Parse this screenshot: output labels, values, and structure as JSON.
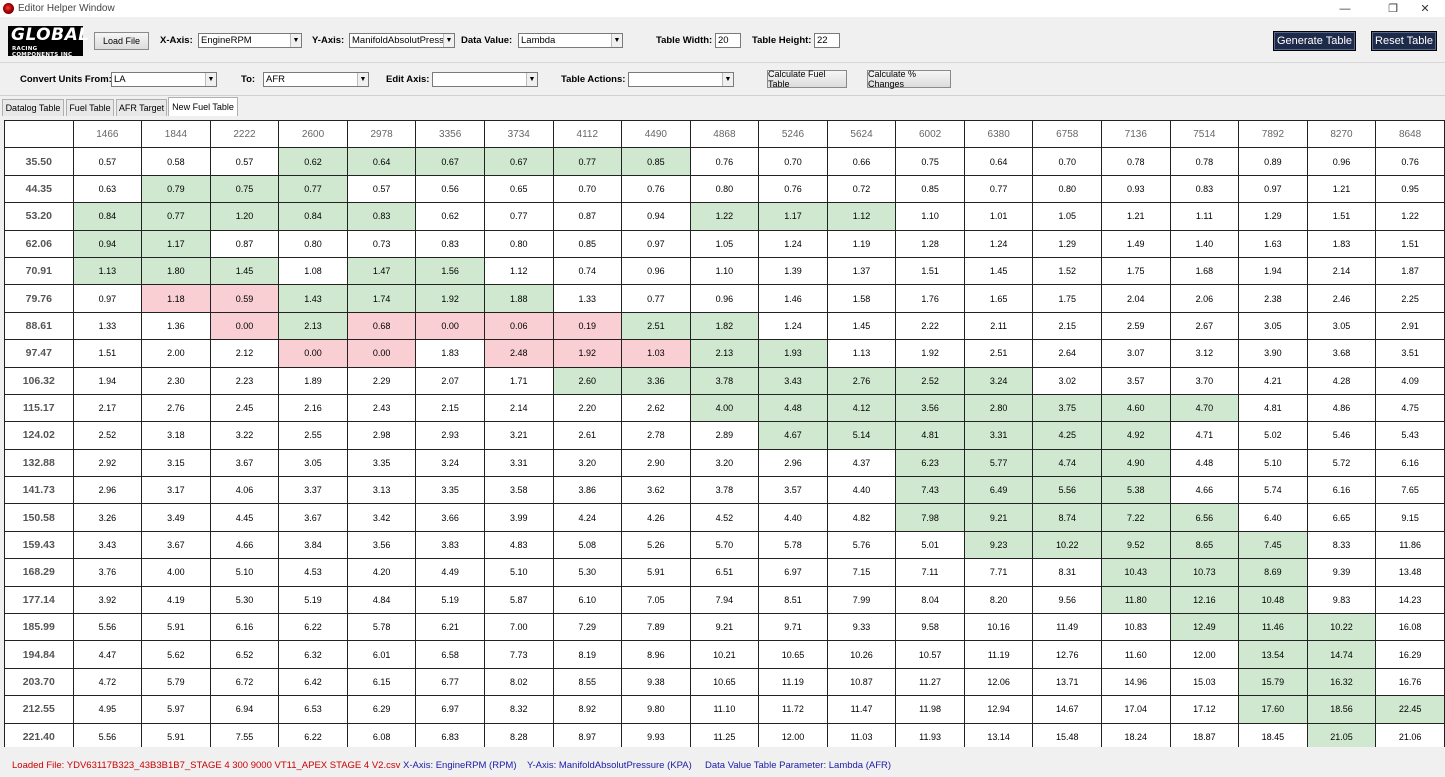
{
  "window": {
    "title": "Editor Helper Window"
  },
  "toolbar1": {
    "logo": {
      "main": "GLOBAL",
      "sub": "RACING COMPONENTS INC"
    },
    "load_file_label": "Load File",
    "x_axis_label": "X-Axis:",
    "x_axis_value": "EngineRPM",
    "y_axis_label": "Y-Axis:",
    "y_axis_value": "ManifoldAbsolutPressu",
    "data_value_label": "Data Value:",
    "data_value_value": "Lambda",
    "table_width_label": "Table Width:",
    "table_width_value": "20",
    "table_height_label": "Table Height:",
    "table_height_value": "22",
    "generate_label": "Generate Table",
    "reset_label": "Reset Table"
  },
  "toolbar2": {
    "convert_from_label": "Convert Units From:",
    "convert_from_value": "LA",
    "to_label": "To:",
    "to_value": "AFR",
    "edit_axis_label": "Edit Axis:",
    "edit_axis_value": "",
    "table_actions_label": "Table Actions:",
    "table_actions_value": "",
    "calc_fuel_label": "Calculate Fuel Table",
    "calc_pct_label": "Calculate % Changes"
  },
  "tabs": [
    "Datalog Table",
    "Fuel Table",
    "AFR Target",
    "New Fuel Table"
  ],
  "table": {
    "columns": [
      "1466",
      "1844",
      "2222",
      "2600",
      "2978",
      "3356",
      "3734",
      "4112",
      "4490",
      "4868",
      "5246",
      "5624",
      "6002",
      "6380",
      "6758",
      "7136",
      "7514",
      "7892",
      "8270",
      "8648"
    ],
    "rows": [
      {
        "label": "35.50",
        "values": [
          "0.57",
          "0.58",
          "0.57",
          "0.62",
          "0.64",
          "0.67",
          "0.67",
          "0.77",
          "0.85",
          "0.76",
          "0.70",
          "0.66",
          "0.75",
          "0.64",
          "0.70",
          "0.78",
          "0.78",
          "0.89",
          "0.96",
          "0.76"
        ],
        "colors": "...gggggg..........."
      },
      {
        "label": "44.35",
        "values": [
          "0.63",
          "0.79",
          "0.75",
          "0.77",
          "0.57",
          "0.56",
          "0.65",
          "0.70",
          "0.76",
          "0.80",
          "0.76",
          "0.72",
          "0.85",
          "0.77",
          "0.80",
          "0.93",
          "0.83",
          "0.97",
          "1.21",
          "0.95"
        ],
        "colors": ".ggg................"
      },
      {
        "label": "53.20",
        "values": [
          "0.84",
          "0.77",
          "1.20",
          "0.84",
          "0.83",
          "0.62",
          "0.77",
          "0.87",
          "0.94",
          "1.22",
          "1.17",
          "1.12",
          "1.10",
          "1.01",
          "1.05",
          "1.21",
          "1.11",
          "1.29",
          "1.51",
          "1.22"
        ],
        "colors": "ggggg....ggg........"
      },
      {
        "label": "62.06",
        "values": [
          "0.94",
          "1.17",
          "0.87",
          "0.80",
          "0.73",
          "0.83",
          "0.80",
          "0.85",
          "0.97",
          "1.05",
          "1.24",
          "1.19",
          "1.28",
          "1.24",
          "1.29",
          "1.49",
          "1.40",
          "1.63",
          "1.83",
          "1.51"
        ],
        "colors": "gg.................."
      },
      {
        "label": "70.91",
        "values": [
          "1.13",
          "1.80",
          "1.45",
          "1.08",
          "1.47",
          "1.56",
          "1.12",
          "0.74",
          "0.96",
          "1.10",
          "1.39",
          "1.37",
          "1.51",
          "1.45",
          "1.52",
          "1.75",
          "1.68",
          "1.94",
          "2.14",
          "1.87"
        ],
        "colors": "ggg.gg.............."
      },
      {
        "label": "79.76",
        "values": [
          "0.97",
          "1.18",
          "0.59",
          "1.43",
          "1.74",
          "1.92",
          "1.88",
          "1.33",
          "0.77",
          "0.96",
          "1.46",
          "1.58",
          "1.76",
          "1.65",
          "1.75",
          "2.04",
          "2.06",
          "2.38",
          "2.46",
          "2.25"
        ],
        "colors": ".rrgggg............."
      },
      {
        "label": "88.61",
        "values": [
          "1.33",
          "1.36",
          "0.00",
          "2.13",
          "0.68",
          "0.00",
          "0.06",
          "0.19",
          "2.51",
          "1.82",
          "1.24",
          "1.45",
          "2.22",
          "2.11",
          "2.15",
          "2.59",
          "2.67",
          "3.05",
          "3.05",
          "2.91"
        ],
        "colors": "..rgrrrrgg.........."
      },
      {
        "label": "97.47",
        "values": [
          "1.51",
          "2.00",
          "2.12",
          "0.00",
          "0.00",
          "1.83",
          "2.48",
          "1.92",
          "1.03",
          "2.13",
          "1.93",
          "1.13",
          "1.92",
          "2.51",
          "2.64",
          "3.07",
          "3.12",
          "3.90",
          "3.68",
          "3.51"
        ],
        "colors": "...rr.rrrgg........."
      },
      {
        "label": "106.32",
        "values": [
          "1.94",
          "2.30",
          "2.23",
          "1.89",
          "2.29",
          "2.07",
          "1.71",
          "2.60",
          "3.36",
          "3.78",
          "3.43",
          "2.76",
          "2.52",
          "3.24",
          "3.02",
          "3.57",
          "3.70",
          "4.21",
          "4.28",
          "4.09"
        ],
        "colors": ".......ggggggg......"
      },
      {
        "label": "115.17",
        "values": [
          "2.17",
          "2.76",
          "2.45",
          "2.16",
          "2.43",
          "2.15",
          "2.14",
          "2.20",
          "2.62",
          "4.00",
          "4.48",
          "4.12",
          "3.56",
          "2.80",
          "3.75",
          "4.60",
          "4.70",
          "4.81",
          "4.86",
          "4.75"
        ],
        "colors": ".........gggggggg..."
      },
      {
        "label": "124.02",
        "values": [
          "2.52",
          "3.18",
          "3.22",
          "2.55",
          "2.98",
          "2.93",
          "3.21",
          "2.61",
          "2.78",
          "2.89",
          "4.67",
          "5.14",
          "4.81",
          "3.31",
          "4.25",
          "4.92",
          "4.71",
          "5.02",
          "5.46",
          "5.43"
        ],
        "colors": "..........gggggg...."
      },
      {
        "label": "132.88",
        "values": [
          "2.92",
          "3.15",
          "3.67",
          "3.05",
          "3.35",
          "3.24",
          "3.31",
          "3.20",
          "2.90",
          "3.20",
          "2.96",
          "4.37",
          "6.23",
          "5.77",
          "4.74",
          "4.90",
          "4.48",
          "5.10",
          "5.72",
          "6.16"
        ],
        "colors": "............gggg...."
      },
      {
        "label": "141.73",
        "values": [
          "2.96",
          "3.17",
          "4.06",
          "3.37",
          "3.13",
          "3.35",
          "3.58",
          "3.86",
          "3.62",
          "3.78",
          "3.57",
          "4.40",
          "7.43",
          "6.49",
          "5.56",
          "5.38",
          "4.66",
          "5.74",
          "6.16",
          "7.65"
        ],
        "colors": "............gggg...."
      },
      {
        "label": "150.58",
        "values": [
          "3.26",
          "3.49",
          "4.45",
          "3.67",
          "3.42",
          "3.66",
          "3.99",
          "4.24",
          "4.26",
          "4.52",
          "4.40",
          "4.82",
          "7.98",
          "9.21",
          "8.74",
          "7.22",
          "6.56",
          "6.40",
          "6.65",
          "9.15"
        ],
        "colors": "............ggggg..."
      },
      {
        "label": "159.43",
        "values": [
          "3.43",
          "3.67",
          "4.66",
          "3.84",
          "3.56",
          "3.83",
          "4.83",
          "5.08",
          "5.26",
          "5.70",
          "5.78",
          "5.76",
          "5.01",
          "9.23",
          "10.22",
          "9.52",
          "8.65",
          "7.45",
          "8.33",
          "11.86"
        ],
        "colors": ".............ggggg.."
      },
      {
        "label": "168.29",
        "values": [
          "3.76",
          "4.00",
          "5.10",
          "4.53",
          "4.20",
          "4.49",
          "5.10",
          "5.30",
          "5.91",
          "6.51",
          "6.97",
          "7.15",
          "7.11",
          "7.71",
          "8.31",
          "10.43",
          "10.73",
          "8.69",
          "9.39",
          "13.48"
        ],
        "colors": "...............ggg.."
      },
      {
        "label": "177.14",
        "values": [
          "3.92",
          "4.19",
          "5.30",
          "5.19",
          "4.84",
          "5.19",
          "5.87",
          "6.10",
          "7.05",
          "7.94",
          "8.51",
          "7.99",
          "8.04",
          "8.20",
          "9.56",
          "11.80",
          "12.16",
          "10.48",
          "9.83",
          "14.23"
        ],
        "colors": "...............ggg.."
      },
      {
        "label": "185.99",
        "values": [
          "5.56",
          "5.91",
          "6.16",
          "6.22",
          "5.78",
          "6.21",
          "7.00",
          "7.29",
          "7.89",
          "9.21",
          "9.71",
          "9.33",
          "9.58",
          "10.16",
          "11.49",
          "10.83",
          "12.49",
          "11.46",
          "10.22",
          "16.08"
        ],
        "colors": "................ggg."
      },
      {
        "label": "194.84",
        "values": [
          "4.47",
          "5.62",
          "6.52",
          "6.32",
          "6.01",
          "6.58",
          "7.73",
          "8.19",
          "8.96",
          "10.21",
          "10.65",
          "10.26",
          "10.57",
          "11.19",
          "12.76",
          "11.60",
          "12.00",
          "13.54",
          "14.74",
          "16.29"
        ],
        "colors": ".................gg."
      },
      {
        "label": "203.70",
        "values": [
          "4.72",
          "5.79",
          "6.72",
          "6.42",
          "6.15",
          "6.77",
          "8.02",
          "8.55",
          "9.38",
          "10.65",
          "11.19",
          "10.87",
          "11.27",
          "12.06",
          "13.71",
          "14.96",
          "15.03",
          "15.79",
          "16.32",
          "16.76"
        ],
        "colors": ".................gg."
      },
      {
        "label": "212.55",
        "values": [
          "4.95",
          "5.97",
          "6.94",
          "6.53",
          "6.29",
          "6.97",
          "8.32",
          "8.92",
          "9.80",
          "11.10",
          "11.72",
          "11.47",
          "11.98",
          "12.94",
          "14.67",
          "17.04",
          "17.12",
          "17.60",
          "18.56",
          "22.45"
        ],
        "colors": ".................ggg"
      },
      {
        "label": "221.40",
        "values": [
          "5.56",
          "5.91",
          "7.55",
          "6.22",
          "6.08",
          "6.83",
          "8.28",
          "8.97",
          "9.93",
          "11.25",
          "12.00",
          "11.03",
          "11.93",
          "13.14",
          "15.48",
          "18.24",
          "18.87",
          "18.45",
          "21.05",
          "21.06"
        ],
        "colors": "..................g."
      }
    ]
  },
  "status": {
    "loaded_file": "Loaded File: YDV63117B323_43B3B1B7_STAGE 4 300 9000 VT11_APEX STAGE 4 V2.csv",
    "x_axis": "X-Axis: EngineRPM (RPM)",
    "y_axis": "Y-Axis: ManifoldAbsolutPressure (KPA)",
    "param": "Data Value Table Parameter: Lambda (AFR)",
    "colors": {
      "loaded_file": "#cc0000",
      "axis": "#1a1aa8",
      "green_cell": "#cfe8cf",
      "red_cell": "#f9cfd3"
    }
  }
}
